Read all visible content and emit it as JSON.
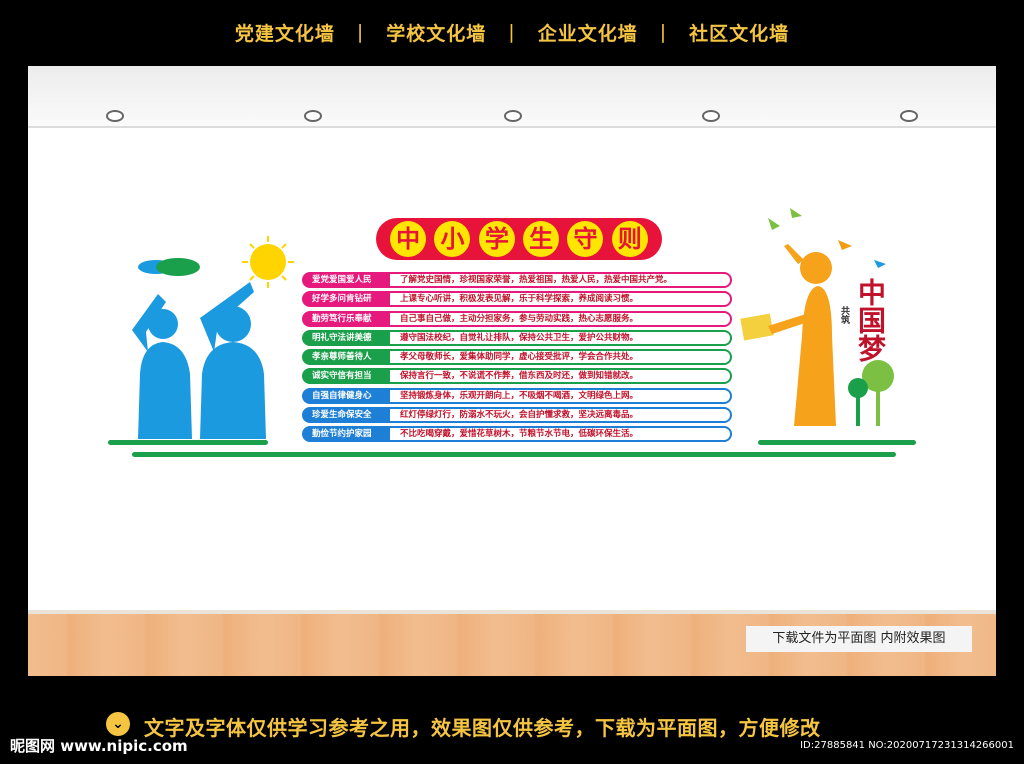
{
  "top_nav": {
    "items": [
      "党建文化墙",
      "学校文化墙",
      "企业文化墙",
      "社区文化墙"
    ],
    "separator": "|"
  },
  "board": {
    "title_chars": [
      "中",
      "小",
      "学",
      "生",
      "守",
      "则"
    ],
    "rules": [
      {
        "label": "爱党爱国爱人民",
        "text": "了解党史国情，珍视国家荣誉，热爱祖国，热爱人民，热爱中国共产党。",
        "color": "#e6197d"
      },
      {
        "label": "好学多问肯钻研",
        "text": "上课专心听讲，积极发表见解，乐于科学探索，养成阅读习惯。",
        "color": "#e6197d"
      },
      {
        "label": "勤劳笃行乐奉献",
        "text": "自己事自己做，主动分担家务，参与劳动实践，热心志愿服务。",
        "color": "#e6197d"
      },
      {
        "label": "明礼守法讲美德",
        "text": "遵守国法校纪，自觉礼让排队，保持公共卫生，爱护公共财物。",
        "color": "#1a9f4a"
      },
      {
        "label": "孝亲尊师善待人",
        "text": "孝父母敬师长，爱集体助同学，虚心接受批评，学会合作共处。",
        "color": "#1a9f4a"
      },
      {
        "label": "诚实守信有担当",
        "text": "保持言行一致，不说谎不作弊，借东西及时还，做到知错就改。",
        "color": "#1a9f4a"
      },
      {
        "label": "自强自律健身心",
        "text": "坚持锻炼身体，乐观开朗向上，不吸烟不喝酒，文明绿色上网。",
        "color": "#1d7fd6"
      },
      {
        "label": "珍爱生命保安全",
        "text": "红灯停绿灯行，防溺水不玩火，会自护懂求救，坚决远离毒品。",
        "color": "#1d7fd6"
      },
      {
        "label": "勤俭节约护家园",
        "text": "不比吃喝穿戴，爱惜花草树木，节粮节水节电，低碳环保生活。",
        "color": "#1d7fd6"
      }
    ],
    "dream_small": "共筑",
    "dream_big": "中国梦"
  },
  "watermark_note": "下载文件为平面图  内附效果图",
  "footer": {
    "note": "文字及字体仅供学习参考之用，效果图仅供参考，下载为平面图，方便修改",
    "brand": "昵图网 www.nipic.com",
    "image_id": "ID:27885841 NO:20200717231314266001"
  },
  "colors": {
    "nav_text": "#f5c542",
    "title_bg": "#e8133a",
    "title_char_bg": "#ffe600",
    "kids_silhouette": "#1b9ae0",
    "girl_silhouette": "#f6a21a"
  }
}
